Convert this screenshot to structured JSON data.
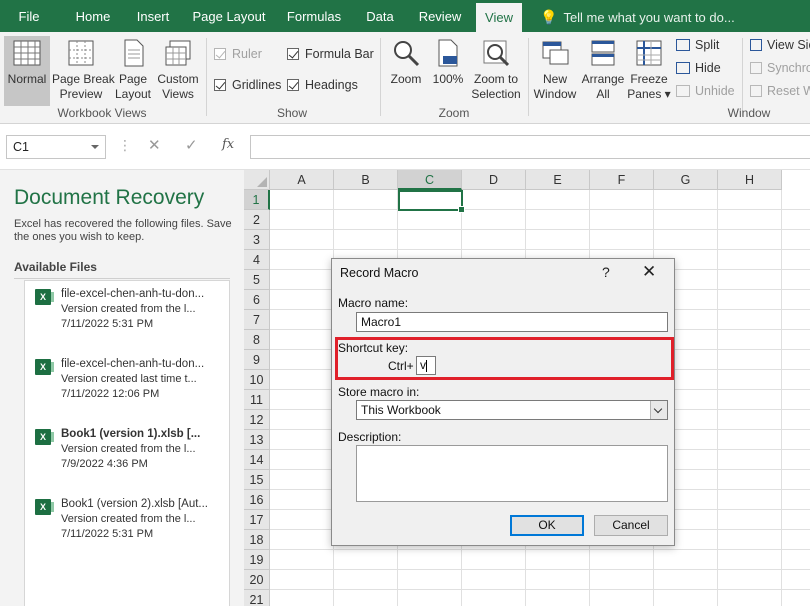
{
  "ribbon_tabs": [
    {
      "label": "File"
    },
    {
      "label": "Home"
    },
    {
      "label": "Insert"
    },
    {
      "label": "Page Layout"
    },
    {
      "label": "Formulas"
    },
    {
      "label": "Data"
    },
    {
      "label": "Review"
    },
    {
      "label": "View"
    }
  ],
  "tell_me": "Tell me what you want to do...",
  "workbook_views": {
    "group_label": "Workbook Views",
    "normal": [
      "Normal"
    ],
    "page_break": [
      "Page Break",
      "Preview"
    ],
    "page_layout": [
      "Page",
      "Layout"
    ],
    "custom_views": [
      "Custom",
      "Views"
    ]
  },
  "show": {
    "group_label": "Show",
    "ruler": "Ruler",
    "formula_bar": "Formula Bar",
    "gridlines": "Gridlines",
    "headings": "Headings"
  },
  "zoom": {
    "group_label": "Zoom",
    "zoom": "Zoom",
    "hundred": "100%",
    "zoom_selection": [
      "Zoom to",
      "Selection"
    ]
  },
  "window": {
    "group_label": "Window",
    "new_window": [
      "New",
      "Window"
    ],
    "arrange_all": [
      "Arrange",
      "All"
    ],
    "freeze_panes": [
      "Freeze",
      "Panes ▾"
    ],
    "split": "Split",
    "hide": "Hide",
    "unhide": "Unhide",
    "view_side": "View Sic",
    "synchronous": "Synchro",
    "reset": "Reset W"
  },
  "formula_bar": {
    "name_box": "C1",
    "cancel_glyph": "✕",
    "enter_glyph": "✓",
    "fx": "fx",
    "value": ""
  },
  "recovery": {
    "title": "Document Recovery",
    "description": "Excel has recovered the following files. Save the ones you wish to keep.",
    "available_label": "Available Files",
    "files": [
      {
        "name": "file-excel-chen-anh-tu-don...",
        "detail": "Version created from the l...",
        "date": "7/11/2022 5:31 PM"
      },
      {
        "name": "file-excel-chen-anh-tu-don...",
        "detail": "Version created last time t...",
        "date": "7/11/2022 12:06 PM"
      },
      {
        "name": "Book1 (version 1).xlsb  [...",
        "detail": "Version created from the l...",
        "date": "7/9/2022 4:36 PM"
      },
      {
        "name": "Book1 (version 2).xlsb  [Aut...",
        "detail": "Version created from the l...",
        "date": "7/11/2022 5:31 PM"
      }
    ]
  },
  "grid": {
    "columns": [
      "A",
      "B",
      "C",
      "D",
      "E",
      "F",
      "G",
      "H"
    ],
    "rows": [
      "1",
      "2",
      "3",
      "4",
      "5",
      "6",
      "7",
      "8",
      "9",
      "10",
      "11",
      "12",
      "13",
      "14",
      "15",
      "16",
      "17",
      "18",
      "19",
      "20",
      "21"
    ],
    "selected_column": "C",
    "selected_row": "1"
  },
  "dialog": {
    "title": "Record Macro",
    "help": "?",
    "close": "✕",
    "macro_name_label": "Macro name:",
    "macro_name_value": "Macro1",
    "shortcut_label": "Shortcut key:",
    "ctrl_label": "Ctrl+",
    "shortcut_value": "v",
    "store_label": "Store macro in:",
    "store_value": "This Workbook",
    "description_label": "Description:",
    "description_value": "",
    "ok": "OK",
    "cancel": "Cancel"
  },
  "colors": {
    "accent": "#217346",
    "highlight": "#e0202a",
    "default_button": "#0078d7"
  }
}
